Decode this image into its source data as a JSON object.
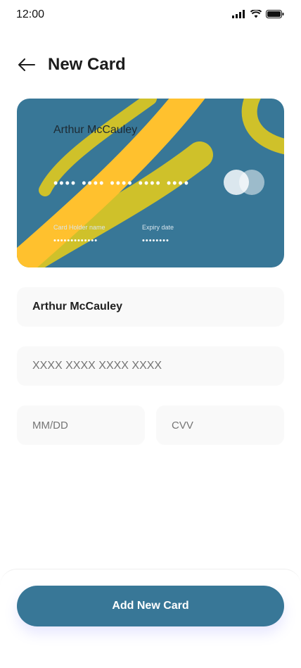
{
  "status_bar": {
    "time": "12:00",
    "icons": [
      "signal-icon",
      "wifi-icon",
      "battery-icon"
    ]
  },
  "header": {
    "title": "New Card",
    "back_icon": "arrow-left-icon"
  },
  "card": {
    "holder_name": "Arthur McCauley",
    "number_masked": "•••• •••• •••• •••• ••••",
    "holder_label": "Card Holder name",
    "holder_value_masked": "•••••••••••••",
    "expiry_label": "Expiry date",
    "expiry_value_masked": "••••••••",
    "colors": {
      "background": "#387797",
      "accent_yellow": "#ffc12e",
      "accent_olive": "#cfc12a"
    }
  },
  "form": {
    "name_value": "Arthur McCauley",
    "number_placeholder": "XXXX XXXX XXXX XXXX",
    "date_placeholder": "MM/DD",
    "cvv_placeholder": "CVV"
  },
  "actions": {
    "add_label": "Add New Card",
    "accent": "#387797"
  }
}
